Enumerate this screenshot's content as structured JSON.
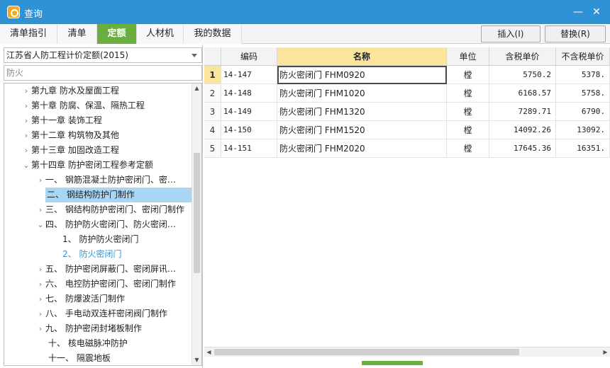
{
  "window": {
    "title": "查询",
    "minimize": "—",
    "close": "✕"
  },
  "tabs": [
    {
      "label": "清单指引"
    },
    {
      "label": "清单"
    },
    {
      "label": "定额"
    },
    {
      "label": "人材机"
    },
    {
      "label": "我的数据"
    }
  ],
  "active_tab": "定额",
  "toolbar": {
    "insert": "插入(I)",
    "replace": "替换(R)"
  },
  "left_panel": {
    "quota_library": "江苏省人防工程计价定额(2015)",
    "search_value": "防火"
  },
  "tree": [
    {
      "text": "第九章  防水及屋面工程",
      "arrow": "›"
    },
    {
      "text": "第十章  防腐、保温、隔热工程",
      "arrow": "›"
    },
    {
      "text": "第十一章  装饰工程",
      "arrow": "›"
    },
    {
      "text": "第十二章  构筑物及其他",
      "arrow": "›"
    },
    {
      "text": "第十三章  加固改造工程",
      "arrow": "›"
    },
    {
      "text": "第十四章  防护密闭工程参考定额",
      "arrow": "⌄"
    },
    {
      "text": "一、  钢筋混凝土防护密闭门、密…",
      "arrow": "›"
    },
    {
      "text": "二、  钢结构防护门制作",
      "arrow": ""
    },
    {
      "text": "三、  钢结构防护密闭门、密闭门制作",
      "arrow": "›"
    },
    {
      "text": "四、  防护防火密闭门、防火密闭…",
      "arrow": "⌄"
    },
    {
      "text": "1、  防护防火密闭门",
      "arrow": ""
    },
    {
      "text": "2、  防火密闭门",
      "arrow": ""
    },
    {
      "text": "五、  防护密闭屏蔽门、密闭屏讯…",
      "arrow": "›"
    },
    {
      "text": "六、  电控防护密闭门、密闭门制作",
      "arrow": "›"
    },
    {
      "text": "七、  防爆波活门制作",
      "arrow": "›"
    },
    {
      "text": "八、  手电动双连杆密闭阀门制作",
      "arrow": "›"
    },
    {
      "text": "九、  防护密闭封堵板制作",
      "arrow": "›"
    },
    {
      "text": "十、  核电磁脉冲防护",
      "arrow": ""
    },
    {
      "text": "十一、  隔震地板",
      "arrow": ""
    }
  ],
  "table": {
    "headers": [
      "编码",
      "名称",
      "单位",
      "含税单价",
      "不含税单价"
    ],
    "rows": [
      {
        "no": "1",
        "code": "14-147",
        "name": "防火密闭门 FHM0920",
        "unit": "樘",
        "price_tax": "5750.2",
        "price_notax": "5378."
      },
      {
        "no": "2",
        "code": "14-148",
        "name": "防火密闭门 FHM1020",
        "unit": "樘",
        "price_tax": "6168.57",
        "price_notax": "5758."
      },
      {
        "no": "3",
        "code": "14-149",
        "name": "防火密闭门 FHM1320",
        "unit": "樘",
        "price_tax": "7289.71",
        "price_notax": "6790."
      },
      {
        "no": "4",
        "code": "14-150",
        "name": "防火密闭门 FHM1520",
        "unit": "樘",
        "price_tax": "14092.26",
        "price_notax": "13092."
      },
      {
        "no": "5",
        "code": "14-151",
        "name": "防火密闭门 FHM2020",
        "unit": "樘",
        "price_tax": "17645.36",
        "price_notax": "16351."
      }
    ]
  },
  "colors": {
    "titlebar": "#2f92d6",
    "active_tab": "#6aae3e",
    "selection": "#a9d6f5",
    "header_highlight": "#fbe49c"
  }
}
